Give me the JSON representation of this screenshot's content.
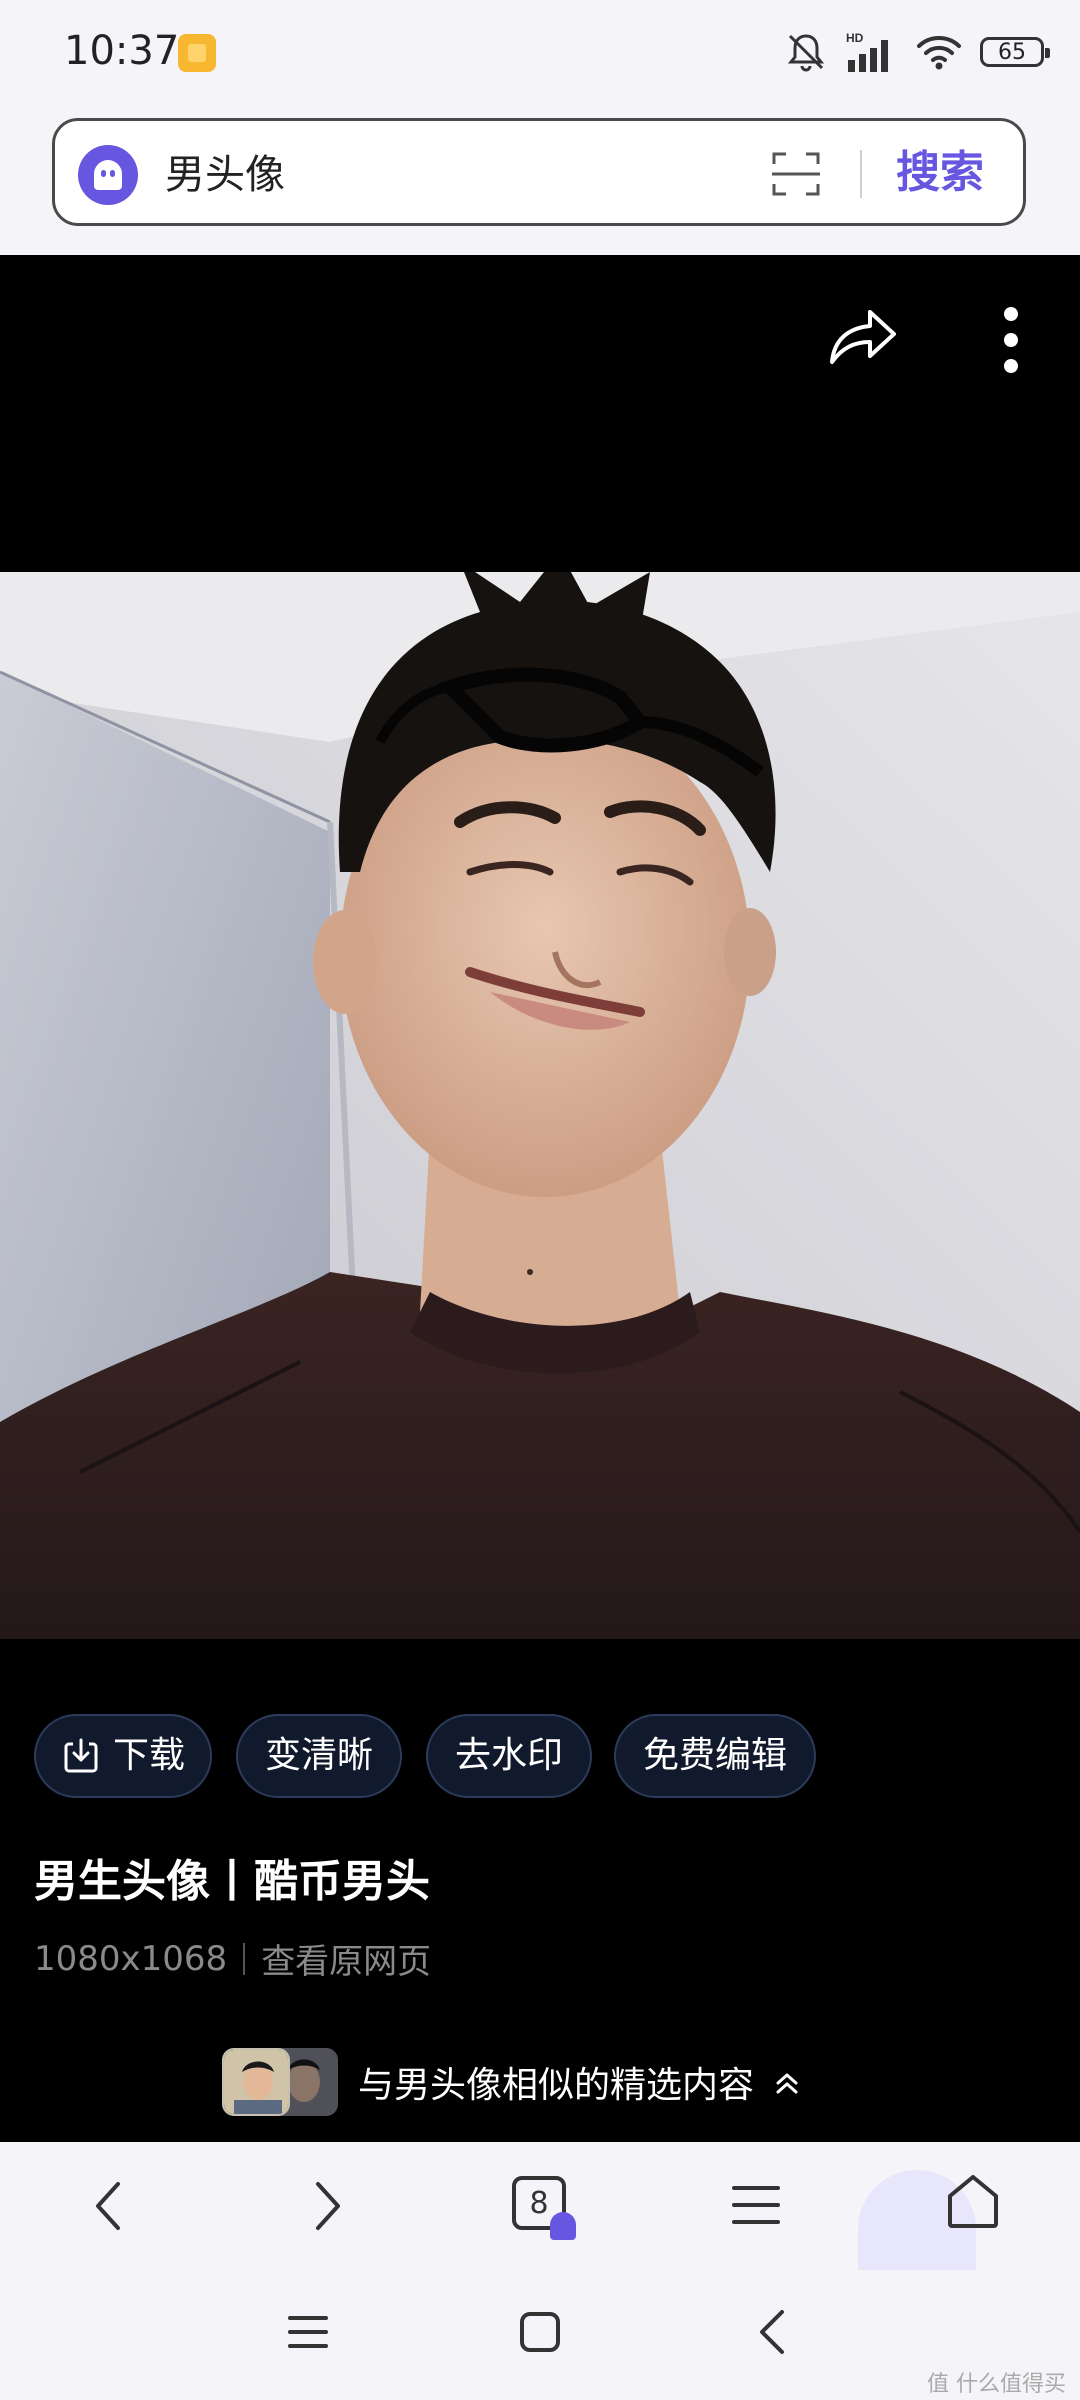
{
  "status_bar": {
    "time": "10:37",
    "battery": "65",
    "network_tag": "HD"
  },
  "search": {
    "query": "男头像",
    "button_label": "搜索"
  },
  "actions": {
    "download": "下载",
    "enhance": "变清晰",
    "remove_watermark": "去水印",
    "free_edit": "免费编辑"
  },
  "image_info": {
    "title": "男生头像丨酷币男头",
    "dimensions": "1080x1068",
    "view_source": "查看原网页"
  },
  "similar": {
    "label": "与男头像相似的精选内容"
  },
  "bottom_nav": {
    "tab_count": "8"
  },
  "watermark": "值 什么值得买",
  "colors": {
    "accent": "#6757e0",
    "background": "#000000",
    "bar": "#f5f4f8"
  }
}
